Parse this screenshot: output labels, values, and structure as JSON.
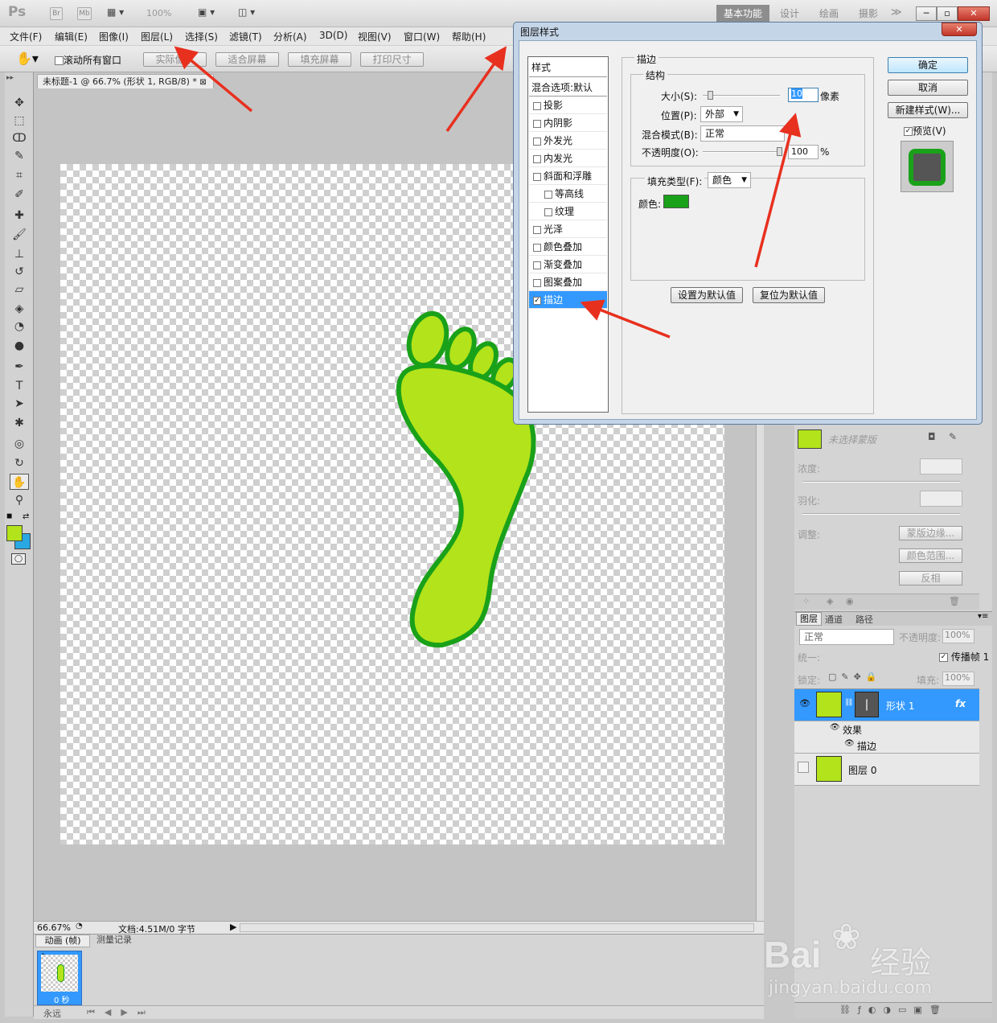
{
  "app": {
    "logo": "Ps",
    "zoom_value": "100%"
  },
  "workspaces": [
    "基本功能",
    "设计",
    "绘画",
    "摄影"
  ],
  "menu": [
    "文件(F)",
    "编辑(E)",
    "图像(I)",
    "图层(L)",
    "选择(S)",
    "滤镜(T)",
    "分析(A)",
    "3D(D)",
    "视图(V)",
    "窗口(W)",
    "帮助(H)"
  ],
  "options": {
    "scroll_all": "滚动所有窗口",
    "buttons": [
      "实际像素",
      "适合屏幕",
      "填充屏幕",
      "打印尺寸"
    ]
  },
  "doc": {
    "tab": "未标题-1 @ 66.7% (形状 1, RGB/8) *",
    "zoom": "66.67%",
    "info": "文档:4.51M/0 字节"
  },
  "anim": {
    "tabs": [
      "动画 (帧)",
      "测量记录"
    ],
    "frame_no": "1",
    "frame_time": "0 秒",
    "loop": "永远"
  },
  "dialog": {
    "title": "图层样式",
    "list_header": "样式",
    "list_items": [
      {
        "label": "混合选项:默认",
        "check": false,
        "indent": false,
        "header": true
      },
      {
        "label": "投影",
        "check": true,
        "checked": false,
        "indent": false
      },
      {
        "label": "内阴影",
        "check": true,
        "checked": false,
        "indent": false
      },
      {
        "label": "外发光",
        "check": true,
        "checked": false,
        "indent": false
      },
      {
        "label": "内发光",
        "check": true,
        "checked": false,
        "indent": false
      },
      {
        "label": "斜面和浮雕",
        "check": true,
        "checked": false,
        "indent": false
      },
      {
        "label": "等高线",
        "check": true,
        "checked": false,
        "indent": true
      },
      {
        "label": "纹理",
        "check": true,
        "checked": false,
        "indent": true
      },
      {
        "label": "光泽",
        "check": true,
        "checked": false,
        "indent": false
      },
      {
        "label": "颜色叠加",
        "check": true,
        "checked": false,
        "indent": false
      },
      {
        "label": "渐变叠加",
        "check": true,
        "checked": false,
        "indent": false
      },
      {
        "label": "图案叠加",
        "check": true,
        "checked": false,
        "indent": false
      },
      {
        "label": "描边",
        "check": true,
        "checked": true,
        "indent": false,
        "selected": true
      }
    ],
    "stroke_group": "描边",
    "structure": "结构",
    "size_label": "大小(S):",
    "size_value": "10",
    "size_unit": "像素",
    "position_label": "位置(P):",
    "position_value": "外部",
    "blend_label": "混合模式(B):",
    "blend_value": "正常",
    "opacity_label": "不透明度(O):",
    "opacity_value": "100",
    "opacity_unit": "%",
    "fill_type_label": "填充类型(F):",
    "fill_type_value": "颜色",
    "color_label": "颜色:",
    "stroke_color": "#1aa11a",
    "set_default": "设置为默认值",
    "reset_default": "复位为默认值",
    "ok": "确定",
    "cancel": "取消",
    "new_style": "新建样式(W)...",
    "preview": "预览(V)"
  },
  "masks": {
    "label": "未选择蒙版",
    "density": "浓度:",
    "feather": "羽化:",
    "adjust": "调整:",
    "edge_btn": "蒙版边缘...",
    "color_range_btn": "颜色范围...",
    "invert_btn": "反相"
  },
  "layers": {
    "tabs": [
      "图层",
      "通道",
      "路径"
    ],
    "blend": "正常",
    "opacity_label": "不透明度:",
    "opacity": "100%",
    "unify": "统一:",
    "propagate": "传播帧 1",
    "lock": "锁定:",
    "fill_label": "填充:",
    "fill": "100%",
    "rows": [
      {
        "name": "形状 1",
        "selected": true
      },
      {
        "name": "效果"
      },
      {
        "name": "描边"
      },
      {
        "name": "图层 0"
      }
    ],
    "fx": "fx"
  },
  "watermark": {
    "brand": "Bai",
    "brand2": "经验",
    "url": "jingyan.baidu.com"
  },
  "colors": {
    "foot_fill": "#b3e31a",
    "foot_stroke": "#1aa11a",
    "accent": "#3399ff",
    "arrow": "#e8301f"
  }
}
